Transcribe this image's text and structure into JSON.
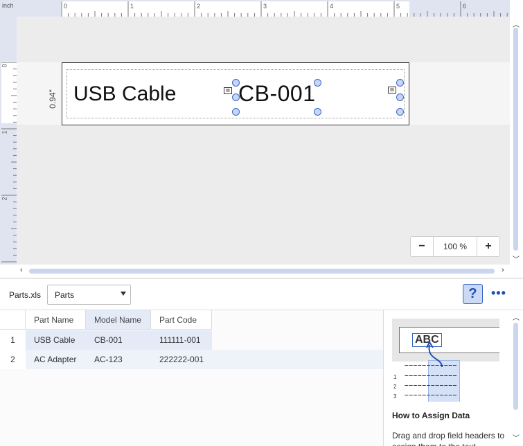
{
  "ruler": {
    "unit": "inch",
    "h_labels": [
      "0",
      "1",
      "2",
      "3",
      "4",
      "5",
      "6"
    ],
    "v_labels": [
      "0",
      "1",
      "2"
    ]
  },
  "label": {
    "length_text": "0.94\"",
    "text1": "USB Cable",
    "text2": "CB-001"
  },
  "zoom": {
    "minus": "−",
    "value": "100 %",
    "plus": "+"
  },
  "toolbar": {
    "file_name": "Parts.xls",
    "sheet_value": "Parts",
    "help_label": "?",
    "more_label": "•••"
  },
  "grid": {
    "columns": [
      "Part Name",
      "Model Name",
      "Part Code"
    ],
    "rows": [
      {
        "num": "1",
        "cells": [
          "USB Cable",
          "CB-001",
          "111111-001"
        ]
      },
      {
        "num": "2",
        "cells": [
          "AC Adapter",
          "AC-123",
          "222222-001"
        ]
      }
    ]
  },
  "help_panel": {
    "illus_text": "ABC",
    "title": "How to Assign Data",
    "body": "Drag and drop field headers to assign them to the text"
  },
  "colors": {
    "accent": "#3a66c4",
    "selection": "#cbd9f5",
    "canvas": "#ececec"
  }
}
